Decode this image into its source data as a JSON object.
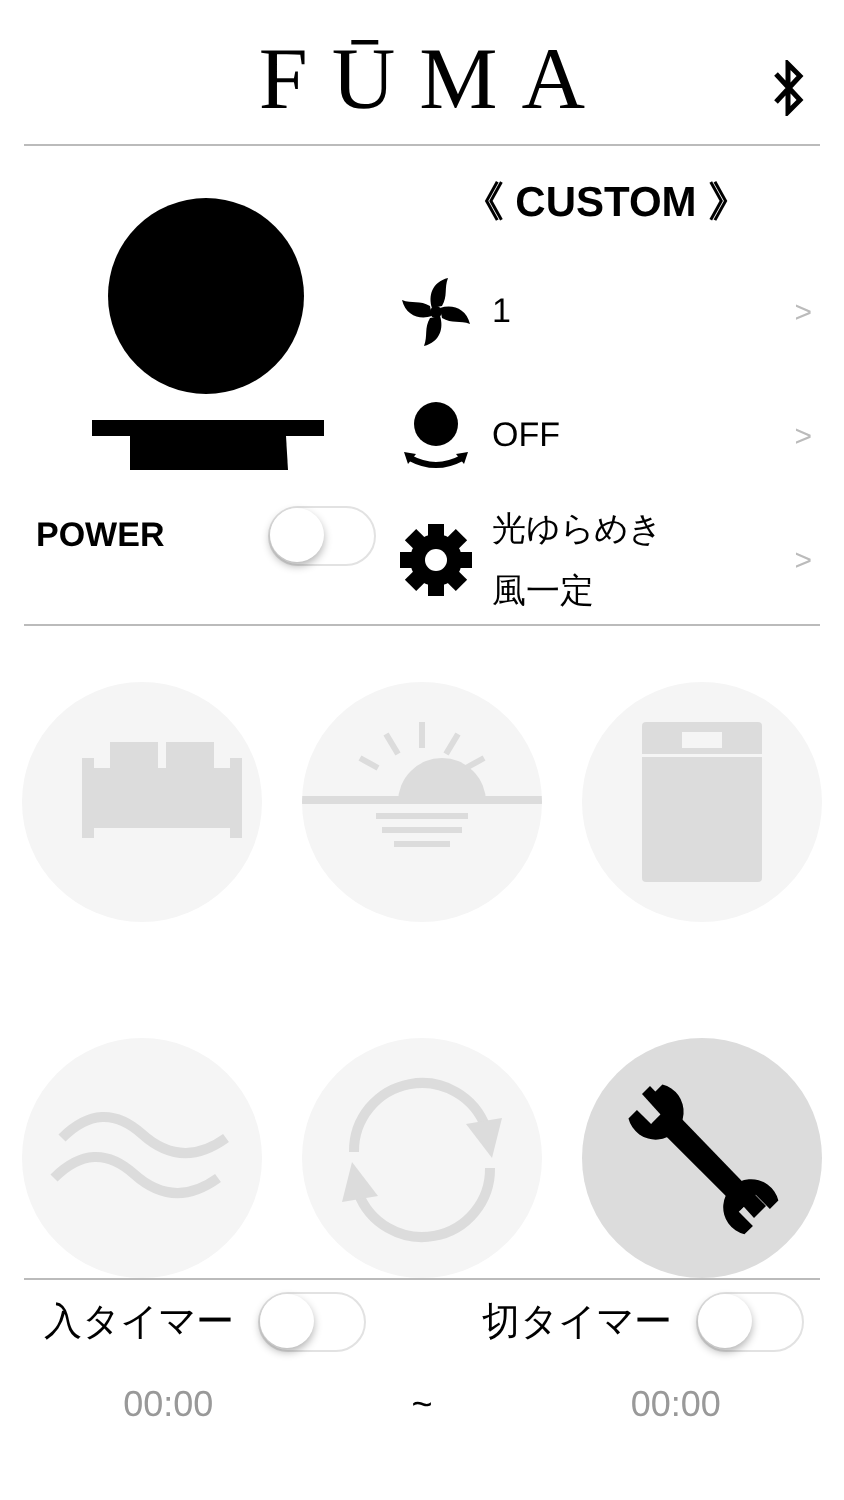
{
  "header": {
    "logo": "FŪMA"
  },
  "mode_title": "《 CUSTOM 》",
  "settings": [
    {
      "kind": "fan",
      "lines": [
        "1"
      ],
      "chevron": ">"
    },
    {
      "kind": "swing",
      "lines": [
        "OFF"
      ],
      "chevron": ">"
    },
    {
      "kind": "gear",
      "lines": [
        "光ゆらめき",
        "風一定"
      ],
      "chevron": ">"
    }
  ],
  "power": {
    "label": "POWER",
    "on": false
  },
  "modes": [
    {
      "kind": "sofa",
      "selected": false
    },
    {
      "kind": "sunrise",
      "selected": false
    },
    {
      "kind": "bed",
      "selected": false
    },
    {
      "kind": "waves",
      "selected": false
    },
    {
      "kind": "cycle",
      "selected": false
    },
    {
      "kind": "tools",
      "selected": true
    }
  ],
  "timers": [
    {
      "label": "入タイマー",
      "on": false,
      "time": "00:00"
    },
    {
      "label": "切タイマー",
      "on": false,
      "time": "00:00"
    }
  ],
  "timer_separator": "~"
}
